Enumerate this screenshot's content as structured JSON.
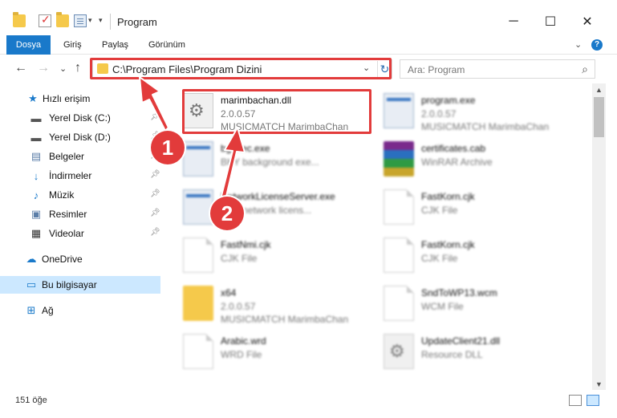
{
  "window": {
    "title": "Program",
    "minimize": "─",
    "maximize": "☐",
    "close": "✕"
  },
  "ribbon": {
    "tabs": [
      "Dosya",
      "Giriş",
      "Paylaş",
      "Görünüm"
    ],
    "collapse": "⌄",
    "help": "?"
  },
  "nav": {
    "back": "←",
    "forward": "→",
    "recent": "⌄",
    "up": "↑",
    "address": "C:\\Program Files\\Program Dizini",
    "refresh": "↻",
    "dropdown": "⌄",
    "search_placeholder": "Ara: Program",
    "search_icon": "⌕"
  },
  "sidebar": {
    "items": [
      {
        "label": "Hızlı erişim",
        "icon": "star-icon",
        "pinned": false
      },
      {
        "label": "Yerel Disk (C:)",
        "icon": "drive-icon",
        "pinned": true
      },
      {
        "label": "Yerel Disk (D:)",
        "icon": "drive-icon",
        "pinned": true
      },
      {
        "label": "Belgeler",
        "icon": "documents-icon",
        "pinned": true
      },
      {
        "label": "İndirmeler",
        "icon": "downloads-icon",
        "pinned": true
      },
      {
        "label": "Müzik",
        "icon": "music-icon",
        "pinned": true
      },
      {
        "label": "Resimler",
        "icon": "pictures-icon",
        "pinned": true
      },
      {
        "label": "Videolar",
        "icon": "videos-icon",
        "pinned": true
      },
      {
        "label": "OneDrive",
        "icon": "onedrive-icon",
        "pinned": false
      },
      {
        "label": "Bu bilgisayar",
        "icon": "computer-icon",
        "pinned": false,
        "selected": true
      },
      {
        "label": "Ağ",
        "icon": "network-icon",
        "pinned": false
      }
    ]
  },
  "files": [
    {
      "name": "marimbachan.dll",
      "line2": "2.0.0.57",
      "line3": "MUSICMATCH MarimbaChan",
      "type": "gear-doc"
    },
    {
      "name": "program.exe",
      "line2": "2.0.0.57",
      "line3": "MUSICMATCH MarimbaChan",
      "type": "exe"
    },
    {
      "name": "bgexec.exe",
      "line2": "BKY background exe...",
      "line3": "",
      "type": "exe"
    },
    {
      "name": "certificates.cab",
      "line2": "WinRAR Archive",
      "line3": "",
      "type": "rar"
    },
    {
      "name": "NetworkLicenseServer.exe",
      "line2": "BKY network licens...",
      "line3": "",
      "type": "exe"
    },
    {
      "name": "FastKorn.cjk",
      "line2": "CJK File",
      "line3": "",
      "type": "doc"
    },
    {
      "name": "FastNmi.cjk",
      "line2": "CJK File",
      "line3": "",
      "type": "doc"
    },
    {
      "name": "FastKorn.cjk",
      "line2": "CJK File",
      "line3": "",
      "type": "doc"
    },
    {
      "name": "x64",
      "line2": "2.0.0.57",
      "line3": "MUSICMATCH MarimbaChan",
      "type": "folder"
    },
    {
      "name": "SndToWP13.wcm",
      "line2": "WCM File",
      "line3": "",
      "type": "doc"
    },
    {
      "name": "Arabic.wrd",
      "line2": "WRD File",
      "line3": "",
      "type": "doc"
    },
    {
      "name": "UpdateClient21.dll",
      "line2": "Resource DLL",
      "line3": "",
      "type": "gear-doc"
    }
  ],
  "status": {
    "count": "151 öğe"
  },
  "callouts": {
    "one": "1",
    "two": "2"
  },
  "colors": {
    "accent": "#1979ca",
    "highlight": "#e23b3b",
    "selection": "#cce8ff"
  }
}
